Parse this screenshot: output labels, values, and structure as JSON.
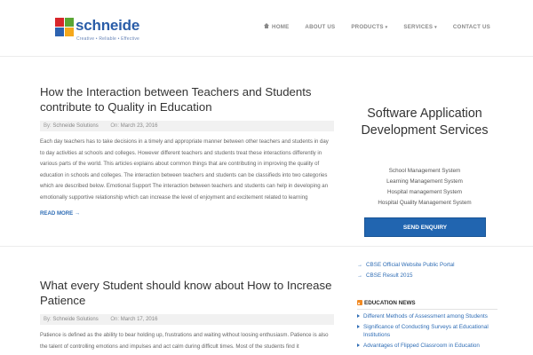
{
  "brand": {
    "name": "schneide",
    "tagline": "Creative • Reliable • Effective"
  },
  "nav": {
    "home": "HOME",
    "about": "ABOUT US",
    "products": "PRODUCTS",
    "services": "SERVICES",
    "contact": "CONTACT US"
  },
  "posts": [
    {
      "title": "How the Interaction between Teachers and Students contribute to Quality in Education",
      "by_label": "By:",
      "author": "Schneide Solutions",
      "on_label": "On:",
      "date": "March 23, 2016",
      "excerpt": "Each day teachers has to take decisions in a timely and appropriate manner between other teachers and students in day to day activities at schools and colleges. However different teachers and students treat these interactions differently in various parts of the world. This articles explains about common things that are contributing in improving the quality of education in schools and colleges. The interaction between teachers and students can be classifieds into two categories which are described below. Emotional Support The interaction between teachers and students can help in developing an emotionally supportive relationship which can increase the level of enjoyment and excitement related to learning",
      "read_more": "READ MORE →"
    },
    {
      "title": "What every Student should know about How to Increase Patience",
      "by_label": "By:",
      "author": "Schneide Solutions",
      "on_label": "On:",
      "date": "March 17, 2016",
      "excerpt": "Patience is defined as the ability to bear holding up, frustrations and waiting without loosing enthusiasm. Patience is also the talent of controlling emotions and impulses and act calm during difficult times. Most of the students find it"
    }
  ],
  "sidebar": {
    "promo_title": "Software Application Development Services",
    "promo_items": [
      "School Management System",
      "Learning Management System",
      "Hospital management System",
      "Hospital Quality Management System"
    ],
    "enquiry_button": "SEND ENQUIRY",
    "links": [
      "CBSE Official Website Public Portal",
      "CBSE Result 2015"
    ],
    "news_heading": "EDUCATION NEWS",
    "news": [
      "Different Methods of Assessment among Students",
      "Significance of Conducting Surveys at Educational Institutions",
      "Advantages of Flipped Classroom in Education"
    ]
  }
}
